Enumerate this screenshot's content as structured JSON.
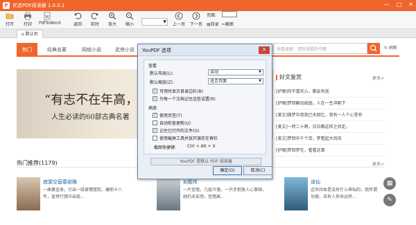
{
  "colors": {
    "accent": "#f0652c",
    "dialog_bg": "#eaeff5"
  },
  "app": {
    "title": "优选PDF阅读器 1.0.0.1",
    "minimize": "—",
    "maximize": "□",
    "close": "✕"
  },
  "toolbar": {
    "open": "打开",
    "print": "打印",
    "pdf2word": "PdfToWord",
    "back": "返回",
    "forward": "前时",
    "zoom_in": "放大",
    "zoom_out": "缩小",
    "zoom_value": "",
    "prev_page": "上一页",
    "next_page": "下一页",
    "page_label": "页面:",
    "page_value": "",
    "bookmark": "目录",
    "screenshot": "截图"
  },
  "doc_tab": {
    "label": "默认页"
  },
  "nav": {
    "tabs": [
      "热门",
      "经典名著",
      "网络小说",
      "武侠小说"
    ],
    "active": 0,
    "search_placeholder": "快看搜索：请你想要的书籍",
    "refresh": "刷新"
  },
  "banner": {
    "line1": "“有志不在年高，",
    "line2": "人生必读的60部古典名著"
  },
  "right_section": {
    "title": "好文鉴赏",
    "more": "更多>",
    "items": [
      "[护眼]你不喜欢么，都会有我",
      "[护眼]梦回翻动故园，人在一生冲刷下",
      "[美文]做梦中我我已天回忆，我有一人个心里有",
      "[美文]一转二十两，日日都这样之间走，",
      "[美文]梦回中千个百，梦看起大风风",
      "[护眼]梦回梦在，看看这事"
    ]
  },
  "recommend": {
    "title": "热门推荐(1179)",
    "more": "更多>",
    "books": [
      {
        "title": "寂寞空庭春欲晚",
        "desc": "一曲黄金身，引出一段爱情蹉跎。康熙十八年，皇帝行猎中出现…"
      },
      {
        "title": "如懿传",
        "desc": "一片宫墙，几层冷落。一只手把美人心事相，她仍未安然，宫墙高…"
      },
      {
        "title": "诛仙",
        "desc": "这世间本是没有什么神仙的，我所谓功德，且有人有命运转…"
      }
    ]
  },
  "dialog": {
    "title": "YouPDF 选项",
    "close": "✕",
    "section_view": "查看",
    "label_layout": "默认布局(L):",
    "layout_value": "自动",
    "label_zoom": "默认缩放(Z):",
    "zoom_value": "适合页面",
    "cb_bookmarks": "可用时显示目录边栏(B)",
    "cb_remember": "为每一个文档记住这些设置(R)",
    "section_advanced": "高级",
    "cb_tabs": "使用页签(T)",
    "cb_autoupdate": "自动检查更新(U)",
    "cb_openfiles": "记住已打开的文件(O)",
    "cb_crop": "使用截屏工具并放开源存在寄栏",
    "label_hotkey": "截图快捷键:",
    "hotkey_value": "Ctrl + Alt + X",
    "default_button": "YouPDF 是默认 PDF 阅读器",
    "ok": "确定(O)",
    "cancel": "取消(C)"
  }
}
